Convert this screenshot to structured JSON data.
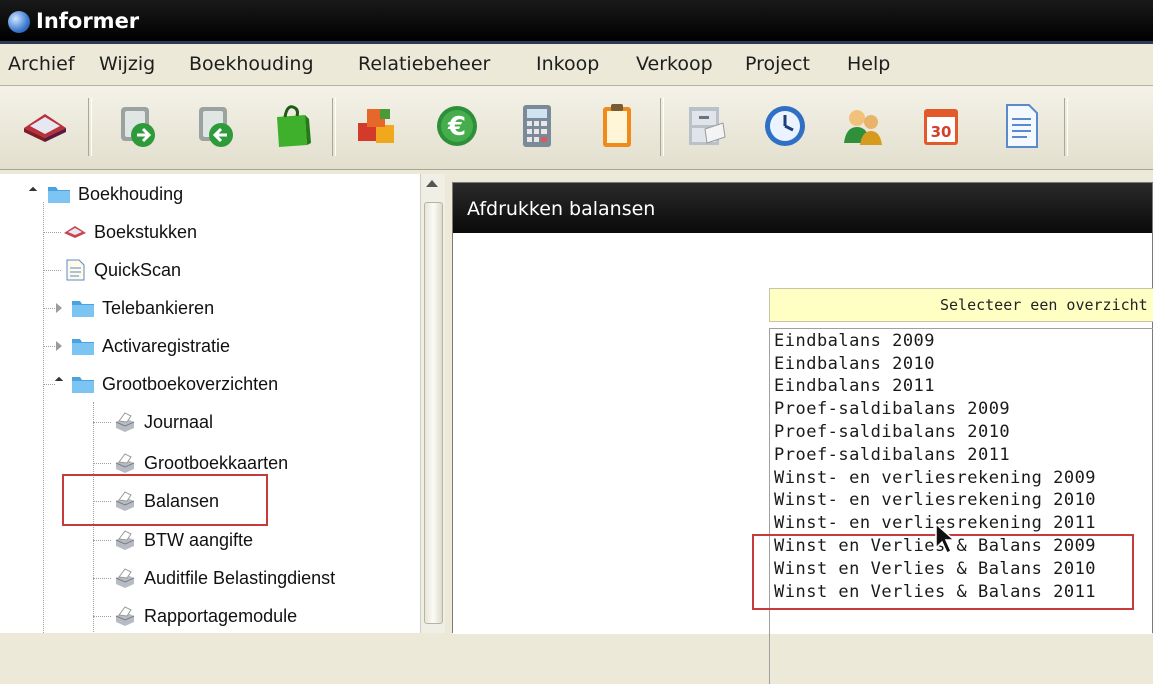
{
  "window": {
    "title": "Informer"
  },
  "menu": [
    "Archief",
    "Wijzig",
    "Boekhouding",
    "Relatiebeheer",
    "Inkoop",
    "Verkoop",
    "Project",
    "Help"
  ],
  "toolbar": {
    "buttons": [
      "boekstukken-icon",
      "arrow-in-icon",
      "arrow-out-icon",
      "shopping-bag-icon",
      "products-icon",
      "euro-icon",
      "calculator-icon",
      "clipboard-icon",
      "cabinet-icon",
      "clock-icon",
      "contacts-icon",
      "calendar-icon",
      "document-icon"
    ],
    "calendar_day": "30"
  },
  "tree": {
    "items": [
      {
        "label": "Boekhouding",
        "icon": "folder-icon",
        "state": "expanded"
      },
      {
        "label": "Boekstukken",
        "icon": "boekstukken-icon"
      },
      {
        "label": "QuickScan",
        "icon": "document-icon"
      },
      {
        "label": "Telebankieren",
        "icon": "folder-icon",
        "state": "collapsed"
      },
      {
        "label": "Activaregistratie",
        "icon": "folder-icon",
        "state": "collapsed"
      },
      {
        "label": "Grootboekoverzichten",
        "icon": "folder-icon",
        "state": "expanded"
      },
      {
        "label": "Journaal",
        "icon": "printer-icon"
      },
      {
        "label": "Grootboekkaarten",
        "icon": "printer-icon"
      },
      {
        "label": "Balansen",
        "icon": "printer-icon",
        "highlighted": true
      },
      {
        "label": "BTW aangifte",
        "icon": "printer-icon"
      },
      {
        "label": "Auditfile Belastingdienst",
        "icon": "printer-icon"
      },
      {
        "label": "Rapportagemodule",
        "icon": "printer-icon"
      }
    ]
  },
  "main": {
    "title": "Afdrukken balansen",
    "overview_header": "Selecteer een overzicht",
    "overviews": [
      "Eindbalans 2009",
      "Eindbalans 2010",
      "Eindbalans 2011",
      "Proef-saldibalans 2009",
      "Proef-saldibalans 2010",
      "Proef-saldibalans 2011",
      "Winst- en verliesrekening 2009",
      "Winst- en verliesrekening 2010",
      "Winst- en verliesrekening 2011",
      "Winst en Verlies & Balans 2009",
      "Winst en Verlies & Balans 2010",
      "Winst en Verlies & Balans 2011"
    ]
  },
  "colors": {
    "highlight_border": "#c83a3a",
    "header_bg": "#ffffc4",
    "titlebar_bg": "#000000"
  }
}
